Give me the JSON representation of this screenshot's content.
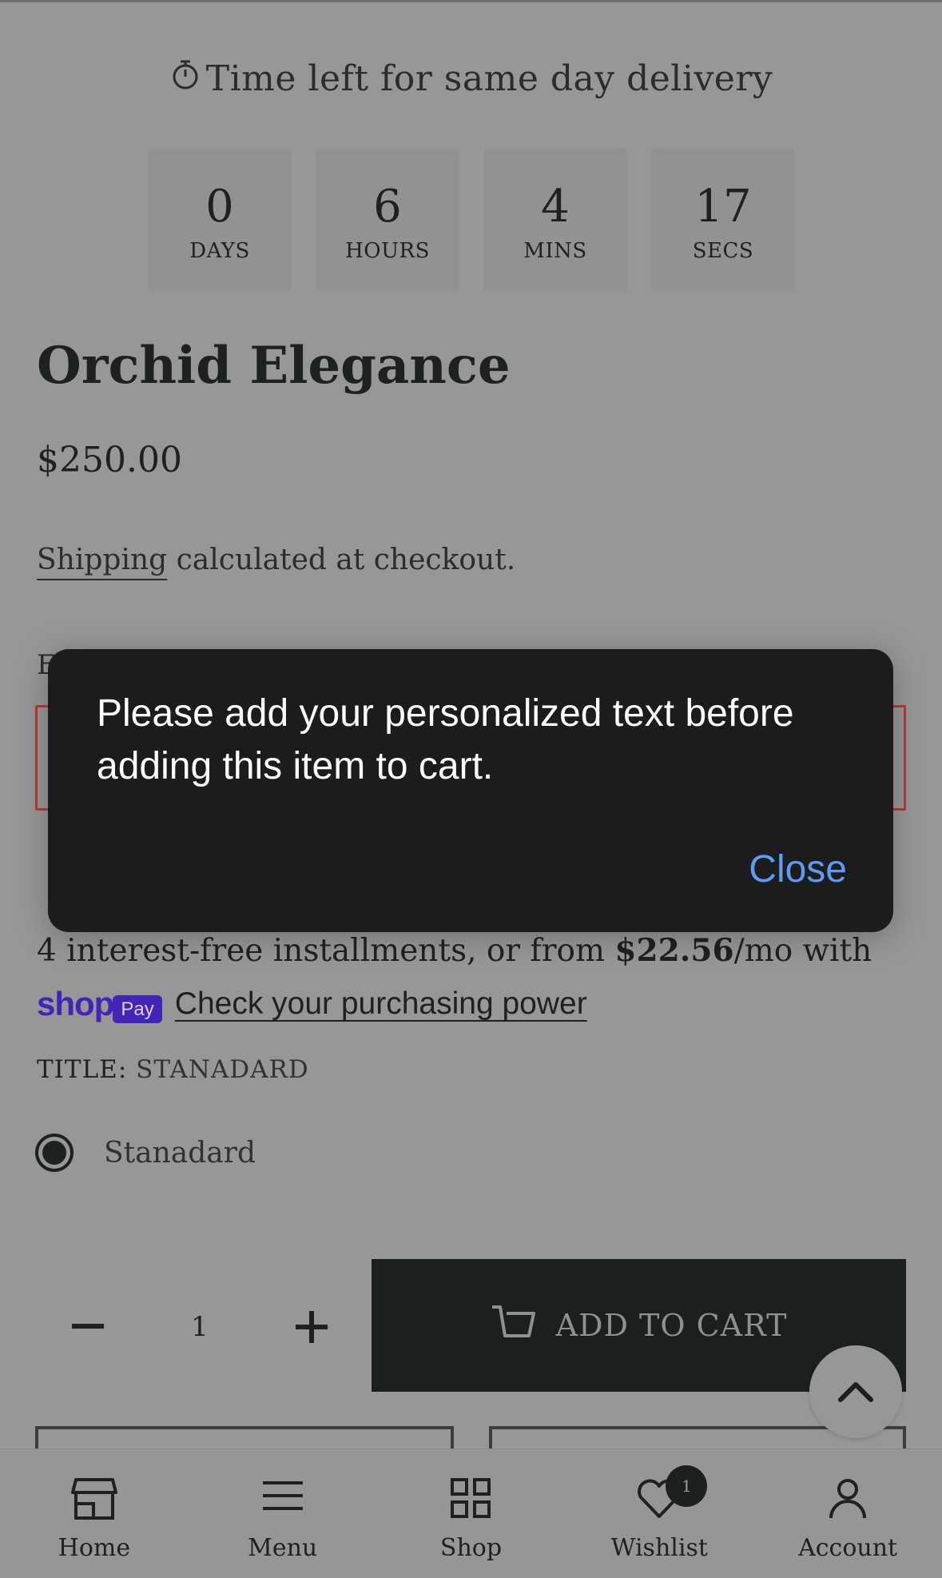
{
  "timer": {
    "heading": "Time left for same day delivery",
    "units": [
      {
        "value": "0",
        "label": "DAYS"
      },
      {
        "value": "6",
        "label": "HOURS"
      },
      {
        "value": "4",
        "label": "MINS"
      },
      {
        "value": "17",
        "label": "SECS"
      }
    ]
  },
  "product": {
    "title": "Orchid Elegance",
    "price": "$250.00",
    "shipping_link": "Shipping",
    "shipping_rest": " calculated at checkout.",
    "field_label_partial": "E"
  },
  "installments": {
    "prefix": "4 interest-free installments, or from ",
    "amount": "$22.56",
    "suffix": "/mo with",
    "shop_word": "shop",
    "pay_badge": "Pay",
    "link": "Check your purchasing power"
  },
  "variant": {
    "option_name": "TITLE:",
    "option_value": "STANADARD",
    "radio_label": "Stanadard"
  },
  "quantity": {
    "minus": "−",
    "value": "1",
    "plus": "+"
  },
  "cart": {
    "add_label": "ADD TO CART"
  },
  "dialog": {
    "message": "Please add your personalized text before adding this item to cart.",
    "close_label": "Close"
  },
  "nav": {
    "items": [
      {
        "label": "Home",
        "icon": "store-icon"
      },
      {
        "label": "Menu",
        "icon": "menu-icon"
      },
      {
        "label": "Shop",
        "icon": "grid-icon"
      },
      {
        "label": "Wishlist",
        "icon": "heart-icon",
        "badge": "1"
      },
      {
        "label": "Account",
        "icon": "user-icon"
      }
    ]
  },
  "colors": {
    "overlay_bg": "#979797",
    "dialog_bg": "#1c1c1e",
    "dialog_link": "#5d9cf5",
    "shop_pay": "#4424b8",
    "dark_button": "#1b201e",
    "error_border": "#b53a3a"
  }
}
